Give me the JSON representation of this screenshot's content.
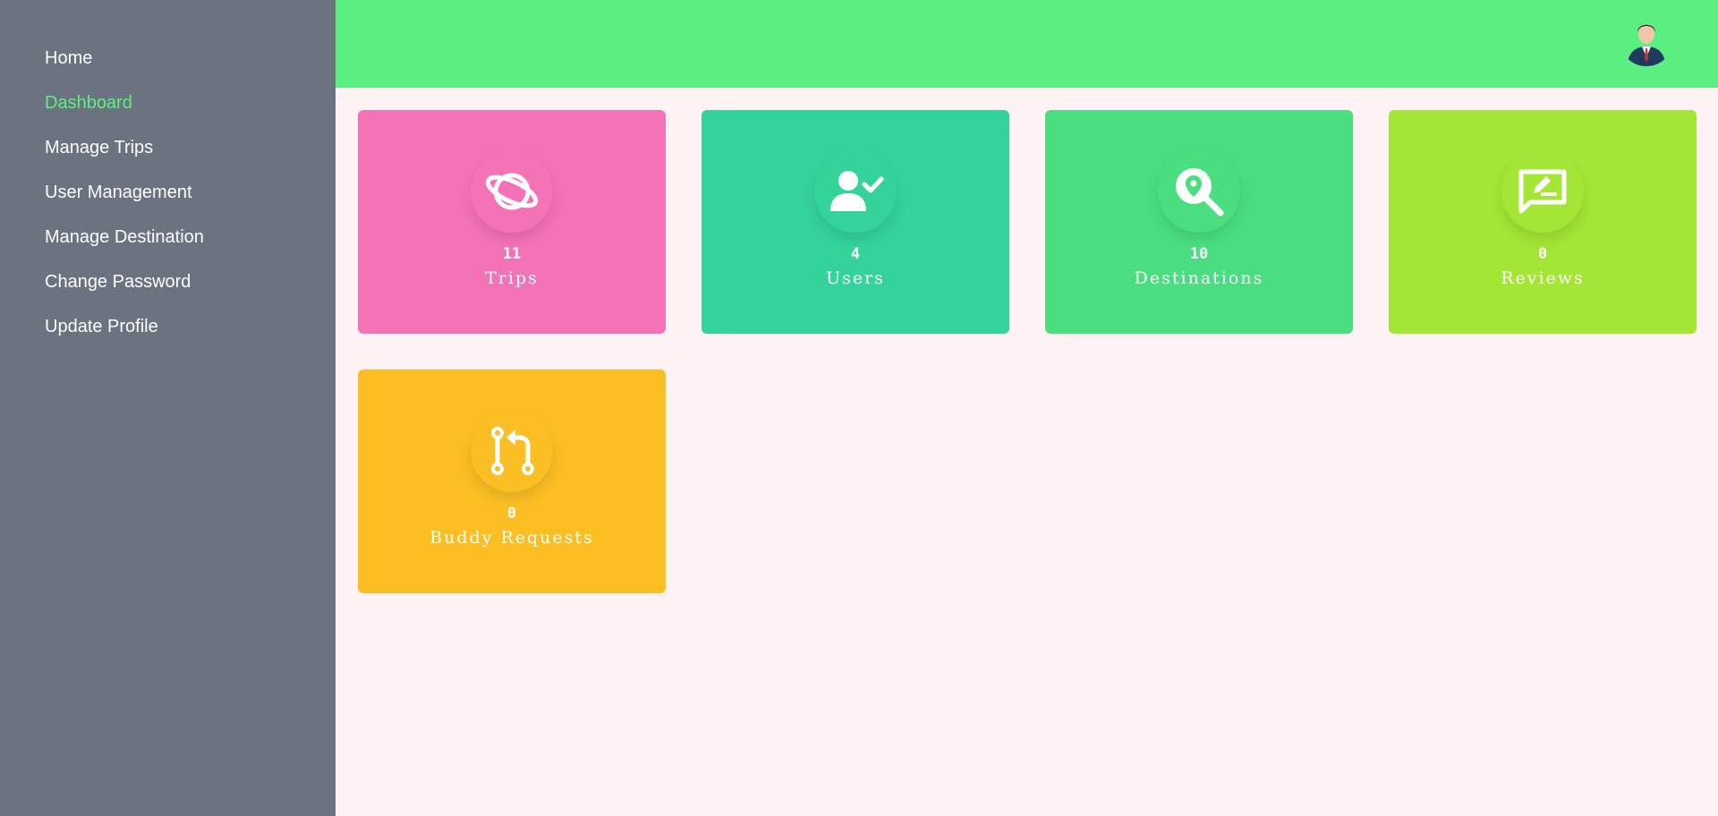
{
  "sidebar": {
    "items": [
      {
        "label": "Home",
        "active": false
      },
      {
        "label": "Dashboard",
        "active": true
      },
      {
        "label": "Manage Trips",
        "active": false
      },
      {
        "label": "User Management",
        "active": false
      },
      {
        "label": "Manage Destination",
        "active": false
      },
      {
        "label": "Change Password",
        "active": false
      },
      {
        "label": "Update Profile",
        "active": false
      }
    ]
  },
  "header": {
    "avatar_icon": "user-avatar"
  },
  "cards": [
    {
      "count": "11",
      "label": "Trips",
      "icon": "planet-icon",
      "color": "#f472b6"
    },
    {
      "count": "4",
      "label": "Users",
      "icon": "user-check-icon",
      "color": "#34d399"
    },
    {
      "count": "10",
      "label": "Destinations",
      "icon": "search-location-icon",
      "color": "#4ade80"
    },
    {
      "count": "0",
      "label": "Reviews",
      "icon": "review-icon",
      "color": "#a3e635"
    },
    {
      "count": "0",
      "label": "Buddy Requests",
      "icon": "pull-request-icon",
      "color": "#fbbf24"
    }
  ],
  "colors": {
    "sidebar_bg": "#6b7280",
    "active_link": "#5ef07f",
    "topbar_bg": "#5bef82",
    "page_bg": "#fff2f5"
  }
}
